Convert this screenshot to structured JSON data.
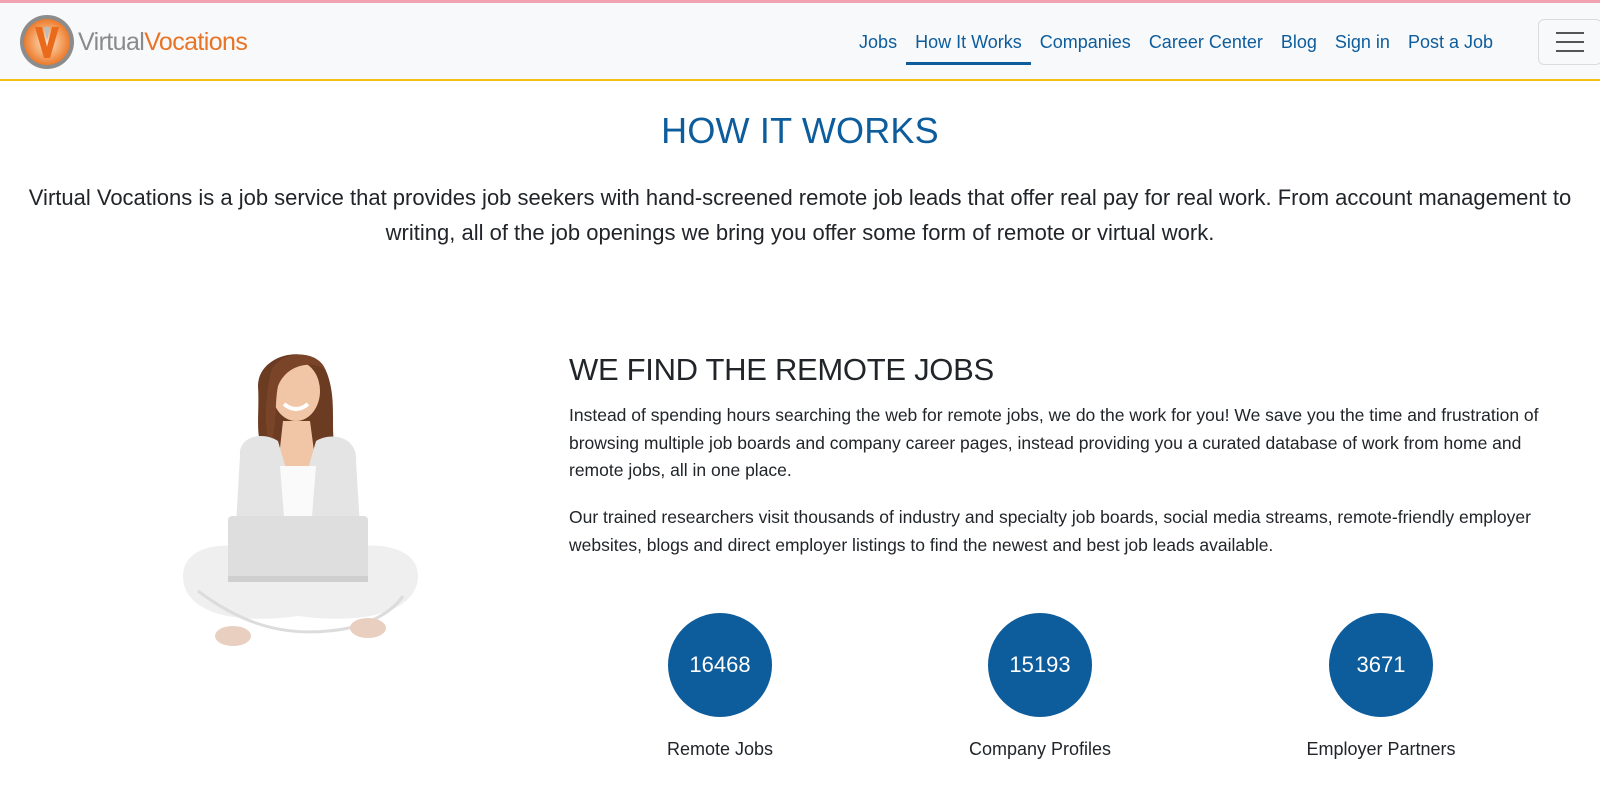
{
  "brand": {
    "logo_letter": "V",
    "name_part1": "Virtual",
    "name_part2": "Vocations",
    "colors": {
      "orange": "#ea7425",
      "gray": "#8a8a8a"
    }
  },
  "nav": {
    "items": [
      {
        "label": "Jobs",
        "active": false
      },
      {
        "label": "How It Works",
        "active": true
      },
      {
        "label": "Companies",
        "active": false
      },
      {
        "label": "Career Center",
        "active": false
      },
      {
        "label": "Blog",
        "active": false
      },
      {
        "label": "Sign in",
        "active": false
      },
      {
        "label": "Post a Job",
        "active": false
      }
    ],
    "menu_icon": "hamburger-icon",
    "accent_color": "#0d5c9c",
    "border_color": "#f5c016"
  },
  "page": {
    "title": "HOW IT WORKS",
    "intro": "Virtual Vocations is a job service that provides job seekers with hand-screened remote job leads that offer real pay for real work. From account management to writing, all of the job openings we bring you offer some form of remote or virtual work."
  },
  "section": {
    "image_alt": "Woman sitting cross-legged with a laptop",
    "title": "WE FIND THE REMOTE JOBS",
    "paragraphs": [
      "Instead of spending hours searching the web for remote jobs, we do the work for you! We save you the time and frustration of browsing multiple job boards and company career pages, instead providing you a curated database of work from home and remote jobs, all in one place.",
      "Our trained researchers visit thousands of industry and specialty job boards, social media streams, remote-friendly employer websites, blogs and direct employer listings to find the newest and best job leads available."
    ]
  },
  "stats": [
    {
      "value": "16468",
      "label": "Remote Jobs"
    },
    {
      "value": "15193",
      "label": "Company Profiles"
    },
    {
      "value": "3671",
      "label": "Employer Partners"
    }
  ]
}
